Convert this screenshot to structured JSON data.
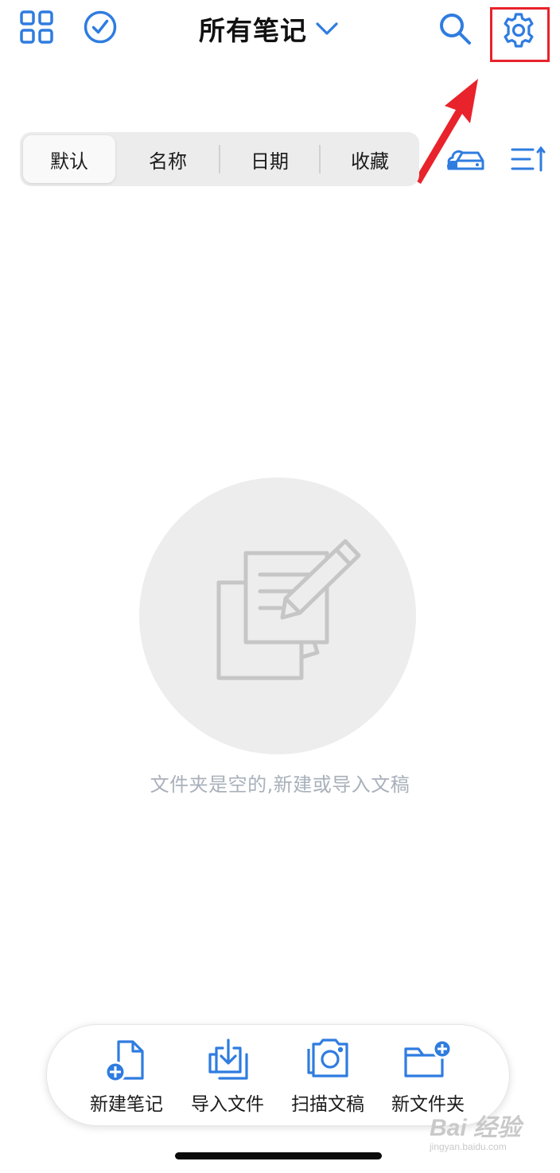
{
  "header": {
    "title": "所有笔记",
    "icons": {
      "grid": "grid-icon",
      "select": "checkmark-circle-icon",
      "dropdown": "chevron-down-icon",
      "search": "search-icon",
      "settings": "gear-icon"
    }
  },
  "annotation": {
    "highlight_color": "#e8232b"
  },
  "sort_tabs": [
    {
      "label": "默认",
      "active": true
    },
    {
      "label": "名称",
      "active": false
    },
    {
      "label": "日期",
      "active": false
    },
    {
      "label": "收藏",
      "active": false
    }
  ],
  "toolbar_icons": {
    "cloud_sync": "cloud-drive-icon",
    "sort_order": "sort-order-icon"
  },
  "empty_state": {
    "icon": "notes-pencil-icon",
    "message": "文件夹是空的,新建或导入文稿"
  },
  "actions": [
    {
      "label": "新建笔记",
      "icon": "new-note-icon"
    },
    {
      "label": "导入文件",
      "icon": "import-file-icon"
    },
    {
      "label": "扫描文稿",
      "icon": "scan-camera-icon"
    },
    {
      "label": "新文件夹",
      "icon": "new-folder-icon"
    }
  ],
  "colors": {
    "accent": "#2f7ce0",
    "text": "#111111",
    "placeholder": "#a9b0ba",
    "segment_bg": "#ececec"
  },
  "watermark": {
    "main": "Bai 经验",
    "sub": "jingyan.baidu.com"
  }
}
